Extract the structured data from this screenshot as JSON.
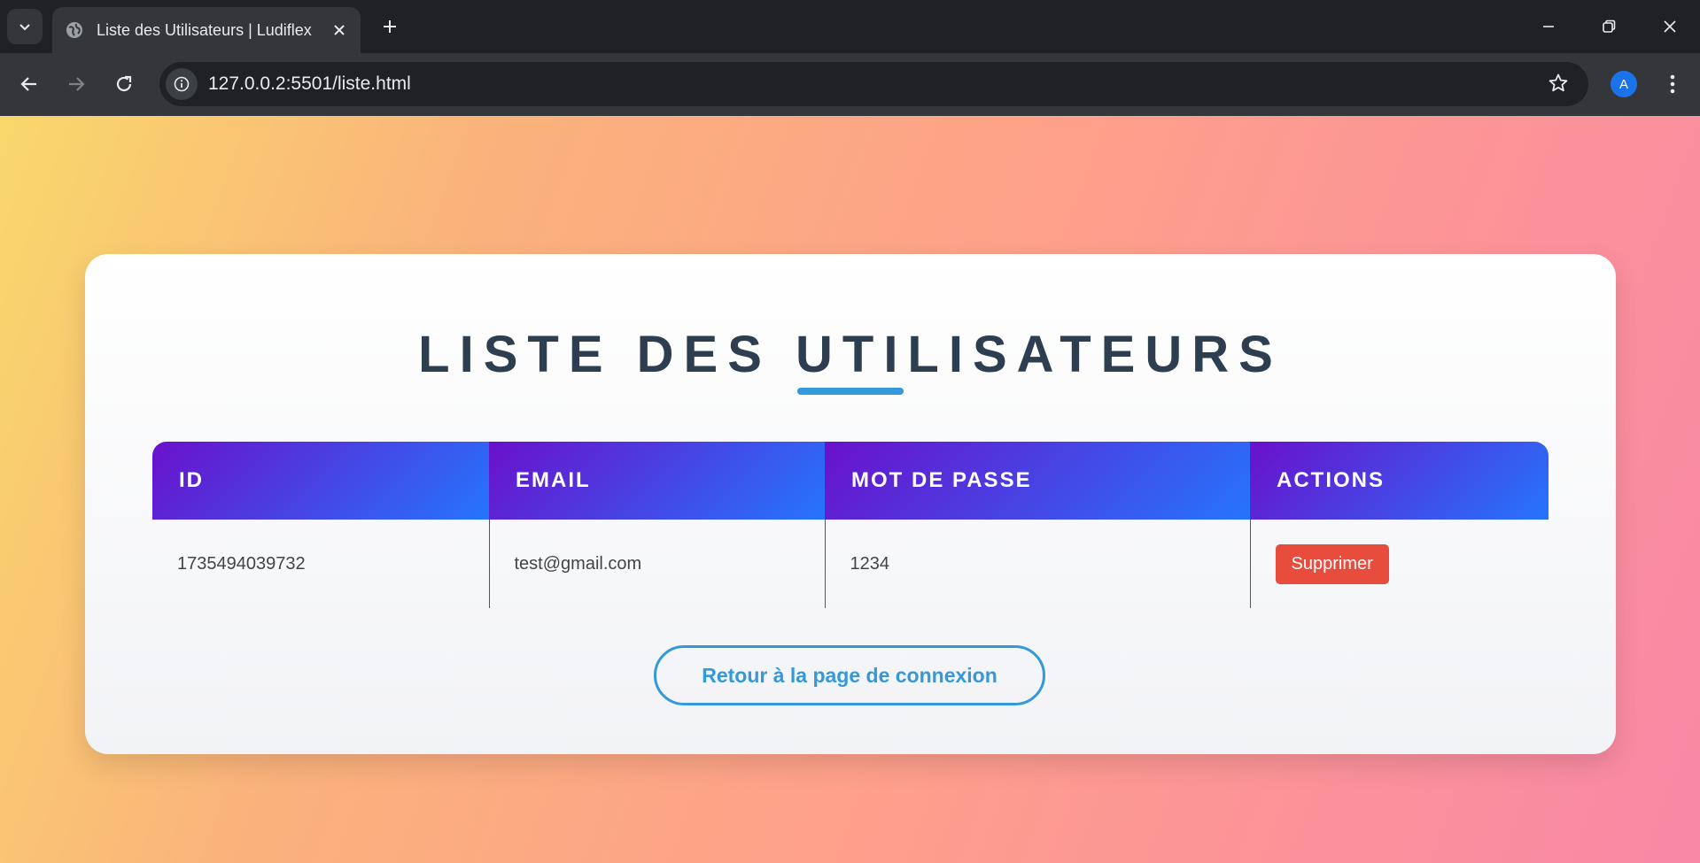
{
  "browser": {
    "tab_title": "Liste des Utilisateurs | Ludiflex",
    "url": "127.0.0.2:5501/liste.html",
    "avatar_letter": "A"
  },
  "main": {
    "heading": "LISTE DES UTILISATEURS",
    "table": {
      "headers": [
        "ID",
        "EMAIL",
        "MOT DE PASSE",
        "ACTIONS"
      ],
      "rows": [
        {
          "id": "1735494039732",
          "email": "test@gmail.com",
          "password": "1234",
          "action_label": "Supprimer"
        }
      ]
    },
    "back_label": "Retour à la page de connexion"
  },
  "colors": {
    "accent": "#3498db",
    "danger": "#e74c3c",
    "heading": "#2c3e50",
    "header_gradient_start": "#6a11cb",
    "header_gradient_end": "#2575fc"
  }
}
